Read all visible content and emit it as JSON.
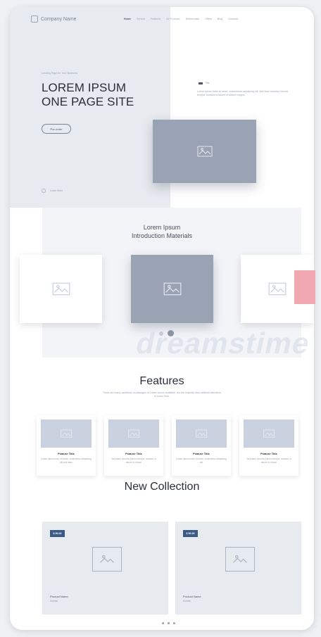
{
  "nav": {
    "brand": "Company Name",
    "links": [
      "Home",
      "Service",
      "Features",
      "All Products",
      "Testimonials",
      "Offers",
      "Blog",
      "Contacts"
    ]
  },
  "hero": {
    "kicker": "Landing Page for Your Business",
    "title_line1": "LOREM IPSUM",
    "title_line2": "ONE PAGE SITE",
    "button": "Pre-order",
    "learn_more": "Learn More",
    "side_tag": "Title",
    "side_text": "Lorem ipsum dolor sit amet, consectetur adipiscing elit, sed diam nonumy eirmod tempor, invidunt ut labore et dolore magna."
  },
  "intro": {
    "title_line1": "Lorem Ipsum",
    "title_line2": "Introduction Materials"
  },
  "watermark": "dreamstime",
  "features": {
    "title": "Features",
    "subtitle": "There are many variations of passages of Lorem Ipsum available, but the majority have suffered alteration in some form.",
    "items": [
      {
        "title": "Feature Title",
        "text": "Lorem ipsum dolor sit amet, consectetur adipiscing elit sed diam"
      },
      {
        "title": "Feature Title",
        "text": "Sed diam nonumy eirmod tempor, invidunt ut labore et dolore"
      },
      {
        "title": "Feature Title",
        "text": "Lorem ipsum dolor sit amet, consectetur adipiscing elit"
      },
      {
        "title": "Feature Title",
        "text": "Sed diam nonumy eirmod tempor, invidunt ut labore et dolore"
      }
    ]
  },
  "collection": {
    "title": "New Collection",
    "products": [
      {
        "price": "$ 90.00",
        "name": "Product Name",
        "sub": "Subtitle"
      },
      {
        "price": "$ 90.00",
        "name": "Product Name",
        "sub": "Subtitle"
      }
    ]
  },
  "colors": {
    "accent_price": "#3c5a86",
    "hero_panel": "#e7eaef",
    "image_placeholder": "#9aa3b4",
    "pink_block": "#f1a8b1"
  }
}
